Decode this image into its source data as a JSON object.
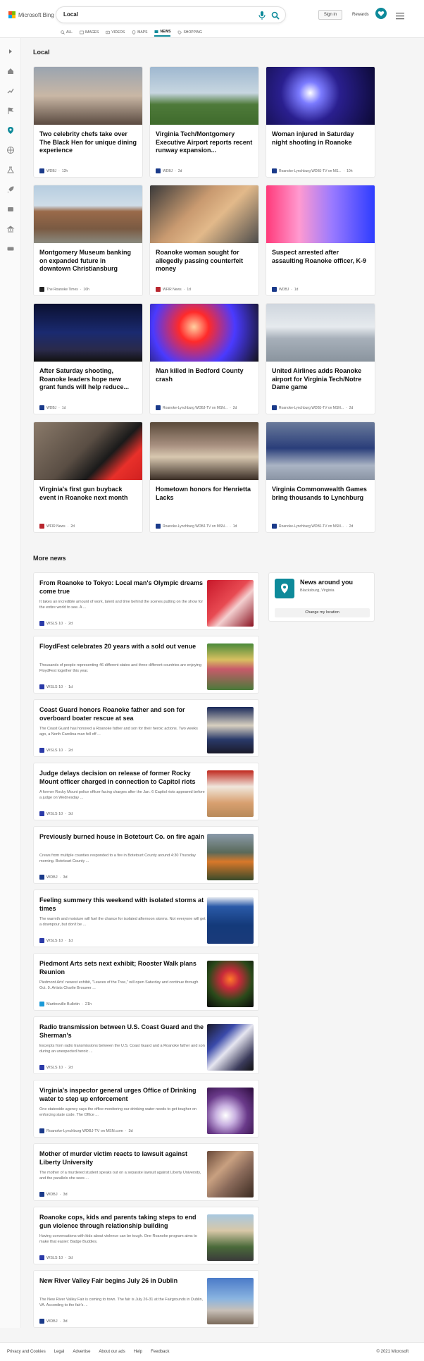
{
  "brand": {
    "name": "Microsoft Bing"
  },
  "search": {
    "query": "Local"
  },
  "header": {
    "sign_in": "Sign in",
    "rewards": "Rewards"
  },
  "tabs": [
    {
      "label": "ALL",
      "icon": "search-icon"
    },
    {
      "label": "IMAGES",
      "icon": "image-icon"
    },
    {
      "label": "VIDEOS",
      "icon": "video-icon"
    },
    {
      "label": "MAPS",
      "icon": "map-icon"
    },
    {
      "label": "NEWS",
      "icon": "news-icon",
      "active": true
    },
    {
      "label": "SHOPPING",
      "icon": "tag-icon"
    }
  ],
  "local": {
    "title": "Local",
    "cards": [
      {
        "title": "Two celebrity chefs take over The Black Hen for unique dining experience",
        "source": "WDBJ",
        "age": "12h"
      },
      {
        "title": "Virginia Tech/Montgomery Executive Airport reports recent runway expansion...",
        "source": "WDBJ",
        "age": "2d"
      },
      {
        "title": "Woman injured in Saturday night shooting in Roanoke",
        "source": "Roanoke-Lynchburg WDBJ-TV on MS...",
        "age": "10h"
      },
      {
        "title": "Montgomery Museum banking on expanded future in downtown Christiansburg",
        "source": "The Roanoke Times",
        "age": "16h"
      },
      {
        "title": "Roanoke woman sought for allegedly passing counterfeit money",
        "source": "WFIR News",
        "age": "1d"
      },
      {
        "title": "Suspect arrested after assaulting Roanoke officer, K-9",
        "source": "WDBJ",
        "age": "1d"
      },
      {
        "title": "After Saturday shooting, Roanoke leaders hope new grant funds will help reduce...",
        "source": "WDBJ",
        "age": "1d"
      },
      {
        "title": "Man killed in Bedford County crash",
        "source": "Roanoke-Lynchburg WDBJ-TV on MSN...",
        "age": "2d"
      },
      {
        "title": "United Airlines adds Roanoke airport for Virginia Tech/Notre Dame game",
        "source": "Roanoke-Lynchburg WDBJ-TV on MSN...",
        "age": "2d"
      },
      {
        "title": "Virginia's first gun buyback event in Roanoke next month",
        "source": "WFIR News",
        "age": "2d"
      },
      {
        "title": "Hometown honors for Henrietta Lacks",
        "source": "Roanoke-Lynchburg WDBJ-TV on MSN...",
        "age": "1d"
      },
      {
        "title": "Virginia Commonwealth Games bring thousands to Lynchburg",
        "source": "Roanoke-Lynchburg WDBJ-TV on MSN...",
        "age": "2d"
      }
    ]
  },
  "more_news": {
    "title": "More news",
    "items": [
      {
        "title": "From Roanoke to Tokyo: Local man's Olympic dreams come true",
        "desc": "It takes an incredible amount of work, talent and time behind the scenes putting on the show for the entire world to see. A ...",
        "source": "WSLS 10",
        "age": "2d"
      },
      {
        "title": "FloydFest celebrates 20 years with a sold out venue",
        "desc": "Thousands of people representing 46 different states and three different countries are enjoying FloydFest together this year.",
        "source": "WSLS 10",
        "age": "1d"
      },
      {
        "title": "Coast Guard honors Roanoke father and son for overboard boater rescue at sea",
        "desc": "The Coast Guard has honored a Roanoke father and son for their heroic actions. Two weeks ago, a North Carolina man fell off ...",
        "source": "WSLS 10",
        "age": "2d"
      },
      {
        "title": "Judge delays decision on release of former Rocky Mount officer charged in connection to Capitol riots",
        "desc": "A former Rocky Mount police officer facing charges after the Jan. 6 Capitol riots appeared before a judge on Wednesday ...",
        "source": "WSLS 10",
        "age": "3d"
      },
      {
        "title": "Previously burned house in Botetourt Co. on fire again",
        "desc": "Crews from multiple counties responded to a fire in Botetourt County around 4:30 Thursday morning. Botetourt County ...",
        "source": "WDBJ",
        "age": "3d"
      },
      {
        "title": "Feeling summery this weekend with isolated storms at times",
        "desc": "The warmth and moisture will fuel the chance for isolated afternoon storms. Not everyone will get a downpour, but don't be ...",
        "source": "WSLS 10",
        "age": "1d"
      },
      {
        "title": "Piedmont Arts sets next exhibit; Rooster Walk plans Reunion",
        "desc": "Piedmont Arts' newest exhibit, \"Leaves of the Tree,\" will open Saturday and continue through Oct. 9. Artists Charlie Brouwer ...",
        "source": "Martinsville Bulletin",
        "age": "21h"
      },
      {
        "title": "Radio transmission between U.S. Coast Guard and the Sherman's",
        "desc": "Excerpts from radio transmissions between the U.S. Coast Guard and a Roanoke father and son during an unexpected heroic ...",
        "source": "WSLS 10",
        "age": "2d"
      },
      {
        "title": "Virginia's inspector general urges Office of Drinking water to step up enforcement",
        "desc": "One statewide agency says the office monitoring our drinking water needs to get tougher on enforcing state code. The Office ...",
        "source": "Roanoke-Lynchburg WDBJ-TV on MSN.com",
        "age": "3d"
      },
      {
        "title": "Mother of murder victim reacts to lawsuit against Liberty University",
        "desc": "The mother of a murdered student speaks out on a separate lawsuit against Liberty University, and the parallels she sees ...",
        "source": "WDBJ",
        "age": "3d"
      },
      {
        "title": "Roanoke cops, kids and parents taking steps to end gun violence through relationship building",
        "desc": "Having conversations with kids about violence can be tough. One Roanoke program aims to make that easier: Badge Buddies.",
        "source": "WSLS 10",
        "age": "3d"
      },
      {
        "title": "New River Valley Fair begins July 26 in Dublin",
        "desc": "The New River Valley Fair is coming to town. The fair is July 26-31 at the Fairgrounds in Dublin, VA. According to the fair's ...",
        "source": "WDBJ",
        "age": "3d"
      }
    ]
  },
  "news_around": {
    "title": "News around you",
    "location": "Blacksburg, Virginia",
    "button": "Change my location"
  },
  "footer": {
    "links": [
      "Privacy and Cookies",
      "Legal",
      "Advertise",
      "About our ads",
      "Help",
      "Feedback"
    ],
    "copyright": "© 2021 Microsoft"
  },
  "colors": {
    "accent": "#0e8a9a",
    "background": "#f5f5f5"
  }
}
